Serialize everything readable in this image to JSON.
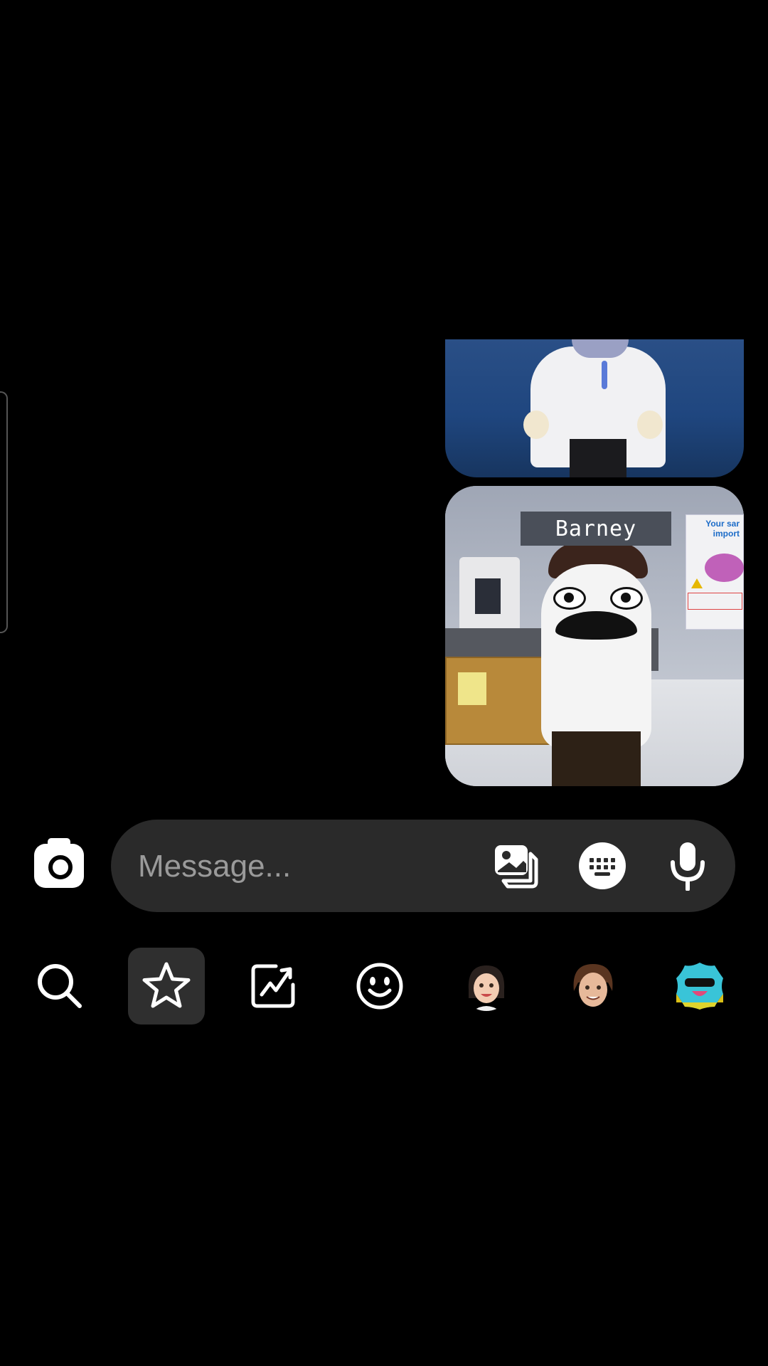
{
  "chat": {
    "messages": [
      {
        "type": "image",
        "description_name": "doctor-avatar-image"
      },
      {
        "type": "image",
        "nameplate": "Barney",
        "poster_text": "Your sar\nimport"
      }
    ]
  },
  "composer": {
    "placeholder": "Message...",
    "icons": [
      "camera-icon",
      "gallery-icon",
      "keyboard-icon",
      "microphone-icon"
    ]
  },
  "bottom_nav": {
    "items": [
      "search-icon",
      "star-icon",
      "trending-icon",
      "emoji-icon",
      "bitmoji-girl",
      "bitmoji-boy",
      "sticker-pack"
    ],
    "selected": "star-icon"
  }
}
